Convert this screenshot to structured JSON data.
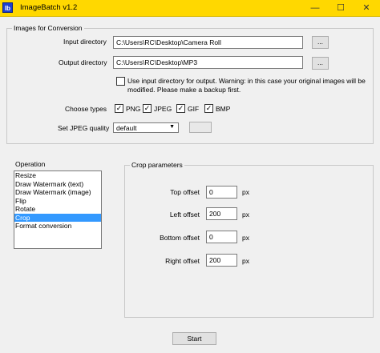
{
  "window": {
    "app_icon_text": "Ib",
    "title": "ImageBatch v1.2",
    "minimize": "—",
    "maximize": "☐",
    "close": "✕"
  },
  "images_group": {
    "title": "Images for Conversion",
    "input_label": "Input directory",
    "input_value": "C:\\Users\\RC\\Desktop\\Camera Roll",
    "output_label": "Output directory",
    "output_value": "C:\\Users\\RC\\Desktop\\MP3",
    "browse_label": "...",
    "use_input_text_line1": "Use input directory for output. Warning: in this case your original images will be",
    "use_input_text_line2": "modified. Please make a backup first.",
    "use_input_checked": false,
    "choose_types_label": "Choose types",
    "types": [
      {
        "label": "PNG",
        "checked": true
      },
      {
        "label": "JPEG",
        "checked": true
      },
      {
        "label": "GIF",
        "checked": true
      },
      {
        "label": "BMP",
        "checked": true
      }
    ],
    "jpeg_quality_label": "Set JPEG quality",
    "jpeg_quality_value": "default",
    "jpeg_quality_extra": ""
  },
  "operation": {
    "title": "Operation",
    "items": [
      "Resize",
      "Draw Watermark (text)",
      "Draw Watermark (image)",
      "Flip",
      "Rotate",
      "Crop",
      "Format conversion"
    ],
    "selected_index": 5
  },
  "crop": {
    "title": "Crop parameters",
    "fields": [
      {
        "label": "Top offset",
        "value": "0",
        "unit": "px"
      },
      {
        "label": "Left offset",
        "value": "200",
        "unit": "px"
      },
      {
        "label": "Bottom offset",
        "value": "0",
        "unit": "px"
      },
      {
        "label": "Right offset",
        "value": "200",
        "unit": "px"
      }
    ]
  },
  "start_label": "Start",
  "check_mark": "✓",
  "dropdown_arrow": "▼"
}
